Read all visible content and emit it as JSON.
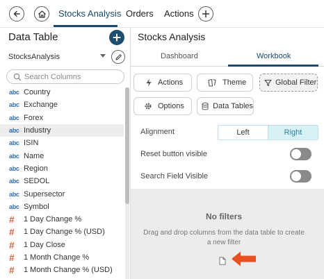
{
  "topbar": {
    "tabs": [
      {
        "label": "Stocks Analysis",
        "active": true
      },
      {
        "label": "Orders",
        "active": false
      },
      {
        "label": "Actions",
        "active": false
      }
    ],
    "icons": {
      "back": "back-arrow-icon",
      "home": "home-icon",
      "add": "plus-icon"
    }
  },
  "left_panel": {
    "title": "Data Table",
    "data_source": "StocksAnalysis",
    "search_placeholder": "Search Columns",
    "columns": [
      {
        "type": "abc",
        "name": "Country"
      },
      {
        "type": "abc",
        "name": "Exchange"
      },
      {
        "type": "abc",
        "name": "Forex"
      },
      {
        "type": "abc",
        "name": "Industry",
        "selected": true
      },
      {
        "type": "abc",
        "name": "ISIN"
      },
      {
        "type": "abc",
        "name": "Name"
      },
      {
        "type": "abc",
        "name": "Region"
      },
      {
        "type": "abc",
        "name": "SEDOL"
      },
      {
        "type": "abc",
        "name": "Supersector"
      },
      {
        "type": "abc",
        "name": "Symbol"
      },
      {
        "type": "#",
        "name": "1 Day Change %"
      },
      {
        "type": "#",
        "name": "1 Day Change % (USD)"
      },
      {
        "type": "#",
        "name": "1 Day Close"
      },
      {
        "type": "#",
        "name": "1 Month Change %"
      },
      {
        "type": "#",
        "name": "1 Month Change % (USD)"
      }
    ]
  },
  "right_panel": {
    "title": "Stocks Analysis",
    "tabs": [
      {
        "label": "Dashboard",
        "active": false
      },
      {
        "label": "Workbook",
        "active": true
      }
    ],
    "buttons": {
      "actions": "Actions",
      "theme": "Theme",
      "global_filter": "Global Filter",
      "options": "Options",
      "data_tables": "Data Tables"
    },
    "alignment": {
      "label": "Alignment",
      "options": [
        "Left",
        "Right"
      ],
      "selected": "Right"
    },
    "reset_button_visible": {
      "label": "Reset button visible",
      "value": false
    },
    "search_field_visible": {
      "label": "Search Field Visible",
      "value": false
    },
    "filters": {
      "title": "No filters",
      "description": "Drag and drop columns from the data table to create a new filter"
    }
  },
  "colors": {
    "accent": "#1a4a6e",
    "abc_type": "#2f6fb3",
    "numeric_type": "#e2623a",
    "arrow": "#e8501f",
    "selected_segment": "#d7f1f7"
  }
}
